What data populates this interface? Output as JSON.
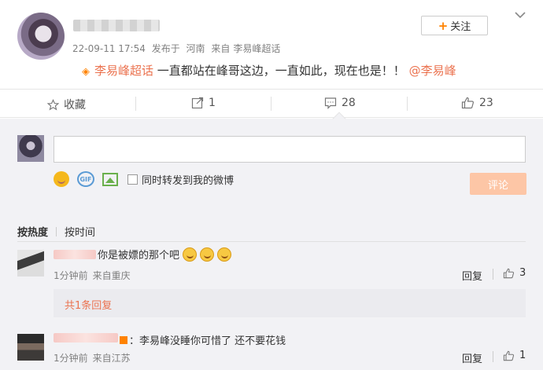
{
  "post": {
    "time": "22-09-11 17:54",
    "published_at_label": "发布于",
    "location": "河南",
    "source_prefix": "来自",
    "source": "李易峰超话",
    "follow_label": "关注",
    "topic_link": "李易峰超话",
    "body_text": " 一直都站在峰哥这边，一直如此，现在也是！！",
    "mention": "@李易峰"
  },
  "actions": {
    "favorite_label": "收藏",
    "repost_count": "1",
    "comment_count": "28",
    "like_count": "23"
  },
  "composer": {
    "checkbox_label": "同时转发到我的微博",
    "submit_label": "评论",
    "gif_label": "GIF"
  },
  "sort": {
    "by_hot": "按热度",
    "by_time": "按时间"
  },
  "comments": [
    {
      "text": "你是被嫖的那个吧",
      "time": "1分钟前",
      "source": "来自重庆",
      "reply_label": "回复",
      "likes": "3",
      "replies_summary": "共1条回复"
    },
    {
      "text": "：李易峰没睡你可惜了 还不要花钱",
      "time": "1分钟前",
      "source": "来自江苏",
      "reply_label": "回复",
      "likes": "1"
    }
  ],
  "colors": {
    "accent": "#ff8200",
    "link": "#eb7350",
    "submit_disabled": "#fdc6a6",
    "panel_bg": "#f2f2f5"
  }
}
